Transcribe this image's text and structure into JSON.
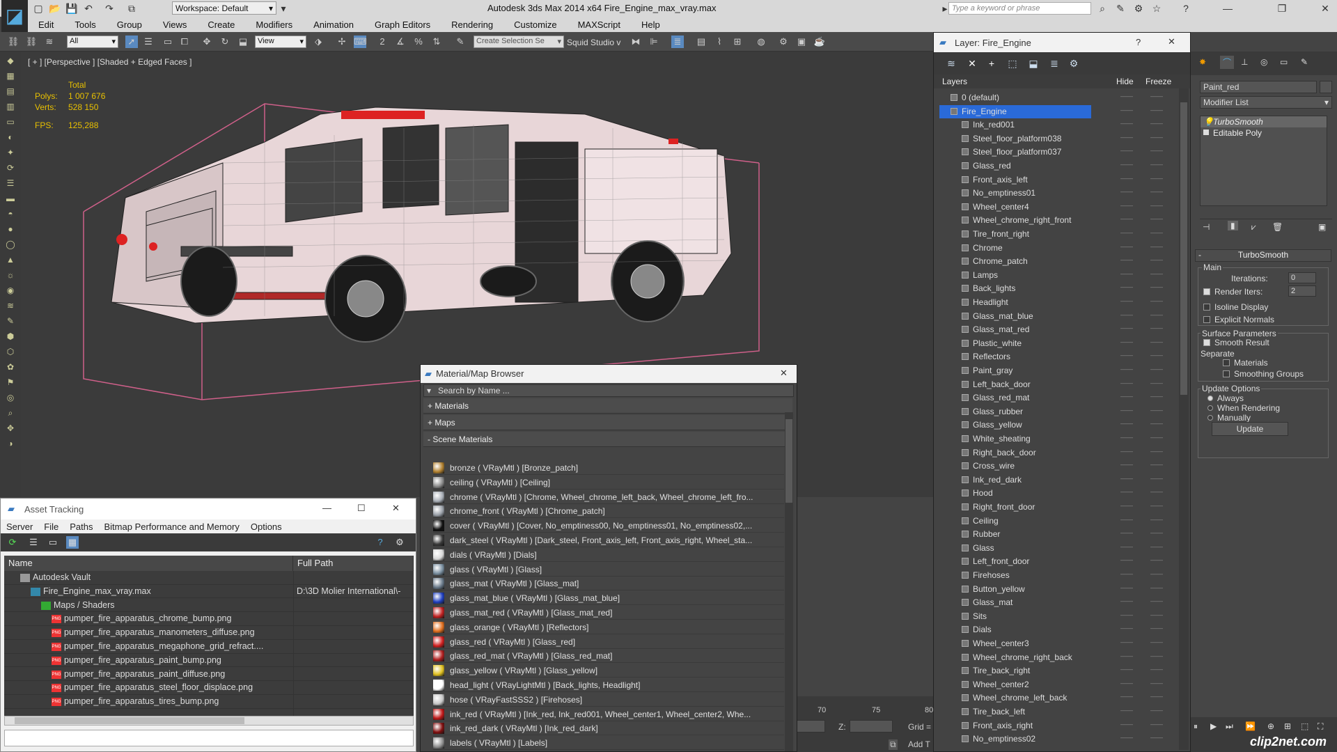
{
  "app": {
    "workspace_label": "Workspace: Default",
    "title": "Autodesk 3ds Max  2014 x64     Fire_Engine_max_vray.max",
    "search_placeholder": "Type a keyword or phrase"
  },
  "menu": [
    "Edit",
    "Tools",
    "Group",
    "Views",
    "Create",
    "Modifiers",
    "Animation",
    "Graph Editors",
    "Rendering",
    "Customize",
    "MAXScript",
    "Help"
  ],
  "toolbar": {
    "selection_filter": "All",
    "ref_coord": "View",
    "named_selection": "Create Selection Se",
    "studio_label": "Squid Studio v"
  },
  "viewport": {
    "label": "[ + ] [Perspective ] [Shaded + Edged Faces ]",
    "stats_total": "Total",
    "polys_label": "Polys:",
    "polys_value": "1 007 676",
    "verts_label": "Verts:",
    "verts_value": "528 150",
    "fps_label": "FPS:",
    "fps_value": "125,288"
  },
  "layer_window": {
    "title": "Layer: Fire_Engine",
    "help": "?",
    "col_layers": "Layers",
    "col_hide": "Hide",
    "col_freeze": "Freeze",
    "layers": [
      {
        "name": "0 (default)",
        "level": 0
      },
      {
        "name": "Fire_Engine",
        "level": 0,
        "selected": true
      },
      {
        "name": "Ink_red001",
        "level": 1
      },
      {
        "name": "Steel_floor_platform038",
        "level": 1
      },
      {
        "name": "Steel_floor_platform037",
        "level": 1
      },
      {
        "name": "Glass_red",
        "level": 1
      },
      {
        "name": "Front_axis_left",
        "level": 1
      },
      {
        "name": "No_emptiness01",
        "level": 1
      },
      {
        "name": "Wheel_center4",
        "level": 1
      },
      {
        "name": "Wheel_chrome_right_front",
        "level": 1
      },
      {
        "name": "Tire_front_right",
        "level": 1
      },
      {
        "name": "Chrome",
        "level": 1
      },
      {
        "name": "Chrome_patch",
        "level": 1
      },
      {
        "name": "Lamps",
        "level": 1
      },
      {
        "name": "Back_lights",
        "level": 1
      },
      {
        "name": "Headlight",
        "level": 1
      },
      {
        "name": "Glass_mat_blue",
        "level": 1
      },
      {
        "name": "Glass_mat_red",
        "level": 1
      },
      {
        "name": "Plastic_white",
        "level": 1
      },
      {
        "name": "Reflectors",
        "level": 1
      },
      {
        "name": "Paint_gray",
        "level": 1
      },
      {
        "name": "Left_back_door",
        "level": 1
      },
      {
        "name": "Glass_red_mat",
        "level": 1
      },
      {
        "name": "Glass_rubber",
        "level": 1
      },
      {
        "name": "Glass_yellow",
        "level": 1
      },
      {
        "name": "White_sheating",
        "level": 1
      },
      {
        "name": "Right_back_door",
        "level": 1
      },
      {
        "name": "Cross_wire",
        "level": 1
      },
      {
        "name": "Ink_red_dark",
        "level": 1
      },
      {
        "name": "Hood",
        "level": 1
      },
      {
        "name": "Right_front_door",
        "level": 1
      },
      {
        "name": "Ceiling",
        "level": 1
      },
      {
        "name": "Rubber",
        "level": 1
      },
      {
        "name": "Glass",
        "level": 1
      },
      {
        "name": "Left_front_door",
        "level": 1
      },
      {
        "name": "Firehoses",
        "level": 1
      },
      {
        "name": "Button_yellow",
        "level": 1
      },
      {
        "name": "Glass_mat",
        "level": 1
      },
      {
        "name": "Sits",
        "level": 1
      },
      {
        "name": "Dials",
        "level": 1
      },
      {
        "name": "Wheel_center3",
        "level": 1
      },
      {
        "name": "Wheel_chrome_right_back",
        "level": 1
      },
      {
        "name": "Tire_back_right",
        "level": 1
      },
      {
        "name": "Wheel_center2",
        "level": 1
      },
      {
        "name": "Wheel_chrome_left_back",
        "level": 1
      },
      {
        "name": "Tire_back_left",
        "level": 1
      },
      {
        "name": "Front_axis_right",
        "level": 1
      },
      {
        "name": "No_emptiness02",
        "level": 1
      }
    ]
  },
  "command_panel": {
    "object_name": "Paint_red",
    "modifier_list": "Modifier List",
    "stack": [
      "TurboSmooth",
      "Editable Poly"
    ],
    "rollout_title": "TurboSmooth",
    "main_label": "Main",
    "iterations_label": "Iterations:",
    "iterations_value": "0",
    "render_iters_label": "Render Iters:",
    "render_iters_value": "2",
    "isoline_label": "Isoline Display",
    "explicit_label": "Explicit Normals",
    "surface_label": "Surface Parameters",
    "smooth_label": "Smooth Result",
    "separate_label": "Separate",
    "materials_label": "Materials",
    "smoothing_label": "Smoothing Groups",
    "update_options": "Update Options",
    "always": "Always",
    "when_rendering": "When Rendering",
    "manually": "Manually",
    "update_btn": "Update"
  },
  "material_browser": {
    "title": "Material/Map Browser",
    "search_placeholder": "Search by Name ...",
    "sec_materials": "+ Materials",
    "sec_maps": "+ Maps",
    "sec_scene": "- Scene Materials",
    "items": [
      {
        "text": "bronze  ( VRayMtl )  [Bronze_patch]",
        "color": "#b08030"
      },
      {
        "text": "ceiling  ( VRayMtl )  [Ceiling]",
        "color": "#8a8a8a"
      },
      {
        "text": "chrome  ( VRayMtl )  [Chrome, Wheel_chrome_left_back, Wheel_chrome_left_fro...",
        "color": "#aab0b8"
      },
      {
        "text": "chrome_front  ( VRayMtl )  [Chrome_patch]",
        "color": "#9aa0a8"
      },
      {
        "text": "cover  ( VRayMtl )  [Cover, No_emptiness00, No_emptiness01, No_emptiness02,...",
        "color": "#111111"
      },
      {
        "text": "dark_steel  ( VRayMtl )  [Dark_steel, Front_axis_left, Front_axis_right, Wheel_sta...",
        "color": "#3a3a3a"
      },
      {
        "text": "dials  ( VRayMtl )  [Dials]",
        "color": "#d8d8d8"
      },
      {
        "text": "glass  ( VRayMtl )  [Glass]",
        "color": "#7a8fa0"
      },
      {
        "text": "glass_mat  ( VRayMtl )  [Glass_mat]",
        "color": "#6a7a8a"
      },
      {
        "text": "glass_mat_blue  ( VRayMtl )  [Glass_mat_blue]",
        "color": "#2040c0"
      },
      {
        "text": "glass_mat_red  ( VRayMtl )  [Glass_mat_red]",
        "color": "#c02020"
      },
      {
        "text": "glass_orange  ( VRayMtl )  [Reflectors]",
        "color": "#e07020"
      },
      {
        "text": "glass_red  ( VRayMtl )  [Glass_red]",
        "color": "#d02020"
      },
      {
        "text": "glass_red_mat  ( VRayMtl )  [Glass_red_mat]",
        "color": "#b02020"
      },
      {
        "text": "glass_yellow  ( VRayMtl )  [Glass_yellow]",
        "color": "#e0c020"
      },
      {
        "text": "head_light  ( VRayLightMtl )  [Back_lights, Headlight]",
        "color": "#ffffff"
      },
      {
        "text": "hose  ( VRayFastSSS2 )  [Firehoses]",
        "color": "#c8c8c8"
      },
      {
        "text": "ink_red  ( VRayMtl )  [Ink_red, Ink_red001, Wheel_center1, Wheel_center2, Whe...",
        "color": "#c01818"
      },
      {
        "text": "ink_red_dark  ( VRayMtl )  [Ink_red_dark]",
        "color": "#801010"
      },
      {
        "text": "labels  ( VRayMtl )  [Labels]",
        "color": "#909090"
      }
    ]
  },
  "asset_tracking": {
    "title": "Asset Tracking",
    "menu": [
      "Server",
      "File",
      "Paths",
      "Bitmap Performance and Memory",
      "Options"
    ],
    "col_name": "Name",
    "col_path": "Full Path",
    "rows": [
      {
        "name": "Autodesk Vault",
        "path": "",
        "level": 1,
        "icon": "vault"
      },
      {
        "name": "Fire_Engine_max_vray.max",
        "path": "D:\\3D Molier International\\-",
        "level": 2,
        "icon": "max"
      },
      {
        "name": "Maps / Shaders",
        "path": "",
        "level": 3,
        "icon": "folder"
      },
      {
        "name": "pumper_fire_apparatus_chrome_bump.png",
        "path": "",
        "level": 4,
        "icon": "png"
      },
      {
        "name": "pumper_fire_apparatus_manometers_diffuse.png",
        "path": "",
        "level": 4,
        "icon": "png"
      },
      {
        "name": "pumper_fire_apparatus_megaphone_grid_refract....",
        "path": "",
        "level": 4,
        "icon": "png"
      },
      {
        "name": "pumper_fire_apparatus_paint_bump.png",
        "path": "",
        "level": 4,
        "icon": "png"
      },
      {
        "name": "pumper_fire_apparatus_paint_diffuse.png",
        "path": "",
        "level": 4,
        "icon": "png"
      },
      {
        "name": "pumper_fire_apparatus_steel_floor_displace.png",
        "path": "",
        "level": 4,
        "icon": "png"
      },
      {
        "name": "pumper_fire_apparatus_tires_bump.png",
        "path": "",
        "level": 4,
        "icon": "png"
      }
    ]
  },
  "timeline": {
    "ticks": [
      "70",
      "75",
      "80"
    ],
    "z_label": "Z:",
    "grid_label": "Grid =",
    "add_label": "Add T"
  },
  "watermark": "clip2net.com"
}
